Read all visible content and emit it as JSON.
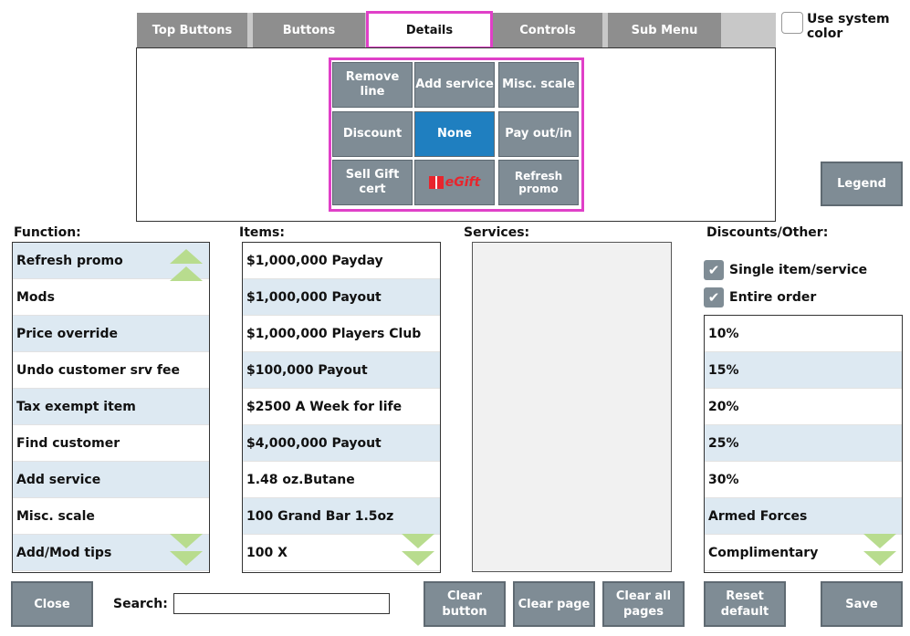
{
  "tabs": [
    "Top Buttons",
    "Buttons",
    "Details",
    "Controls",
    "Sub Menu"
  ],
  "use_system_color": "Use system color",
  "grid": [
    "Remove line",
    "Add service",
    "Misc. scale",
    "Discount",
    "None",
    "Pay out/in",
    "Sell Gift cert",
    "eGift",
    "Refresh promo"
  ],
  "legend": "Legend",
  "headers": {
    "function": "Function:",
    "items": "Items:",
    "services": "Services:",
    "discounts": "Discounts/Other:"
  },
  "functions": [
    "Refresh promo",
    "Mods",
    "Price override",
    "Undo customer srv fee",
    "Tax exempt item",
    "Find customer",
    "Add service",
    "Misc. scale",
    "Add/Mod tips"
  ],
  "items": [
    "$1,000,000 Payday",
    "$1,000,000 Payout",
    "$1,000,000 Players Club",
    "$100,000 Payout",
    "$2500 A Week for life",
    "$4,000,000 Payout",
    "1.48 oz.Butane",
    "100 Grand Bar 1.5oz",
    "100 X"
  ],
  "checks": {
    "single": "Single item/service",
    "entire": "Entire order"
  },
  "discounts": [
    "10%",
    "15%",
    "20%",
    "25%",
    "30%",
    "Armed Forces",
    "Complimentary"
  ],
  "bottom": {
    "close": "Close",
    "search_label": "Search:",
    "search_value": "",
    "clear_button": "Clear button",
    "clear_page": "Clear page",
    "clear_all": "Clear all pages",
    "reset": "Reset default",
    "save": "Save"
  },
  "colors": {
    "accent_highlight": "#e040c8",
    "selected_button": "#1f7fc0",
    "button": "#7f8c95",
    "scroll_arrow": "#b8dc8e",
    "row_alt": "#dde9f2"
  }
}
